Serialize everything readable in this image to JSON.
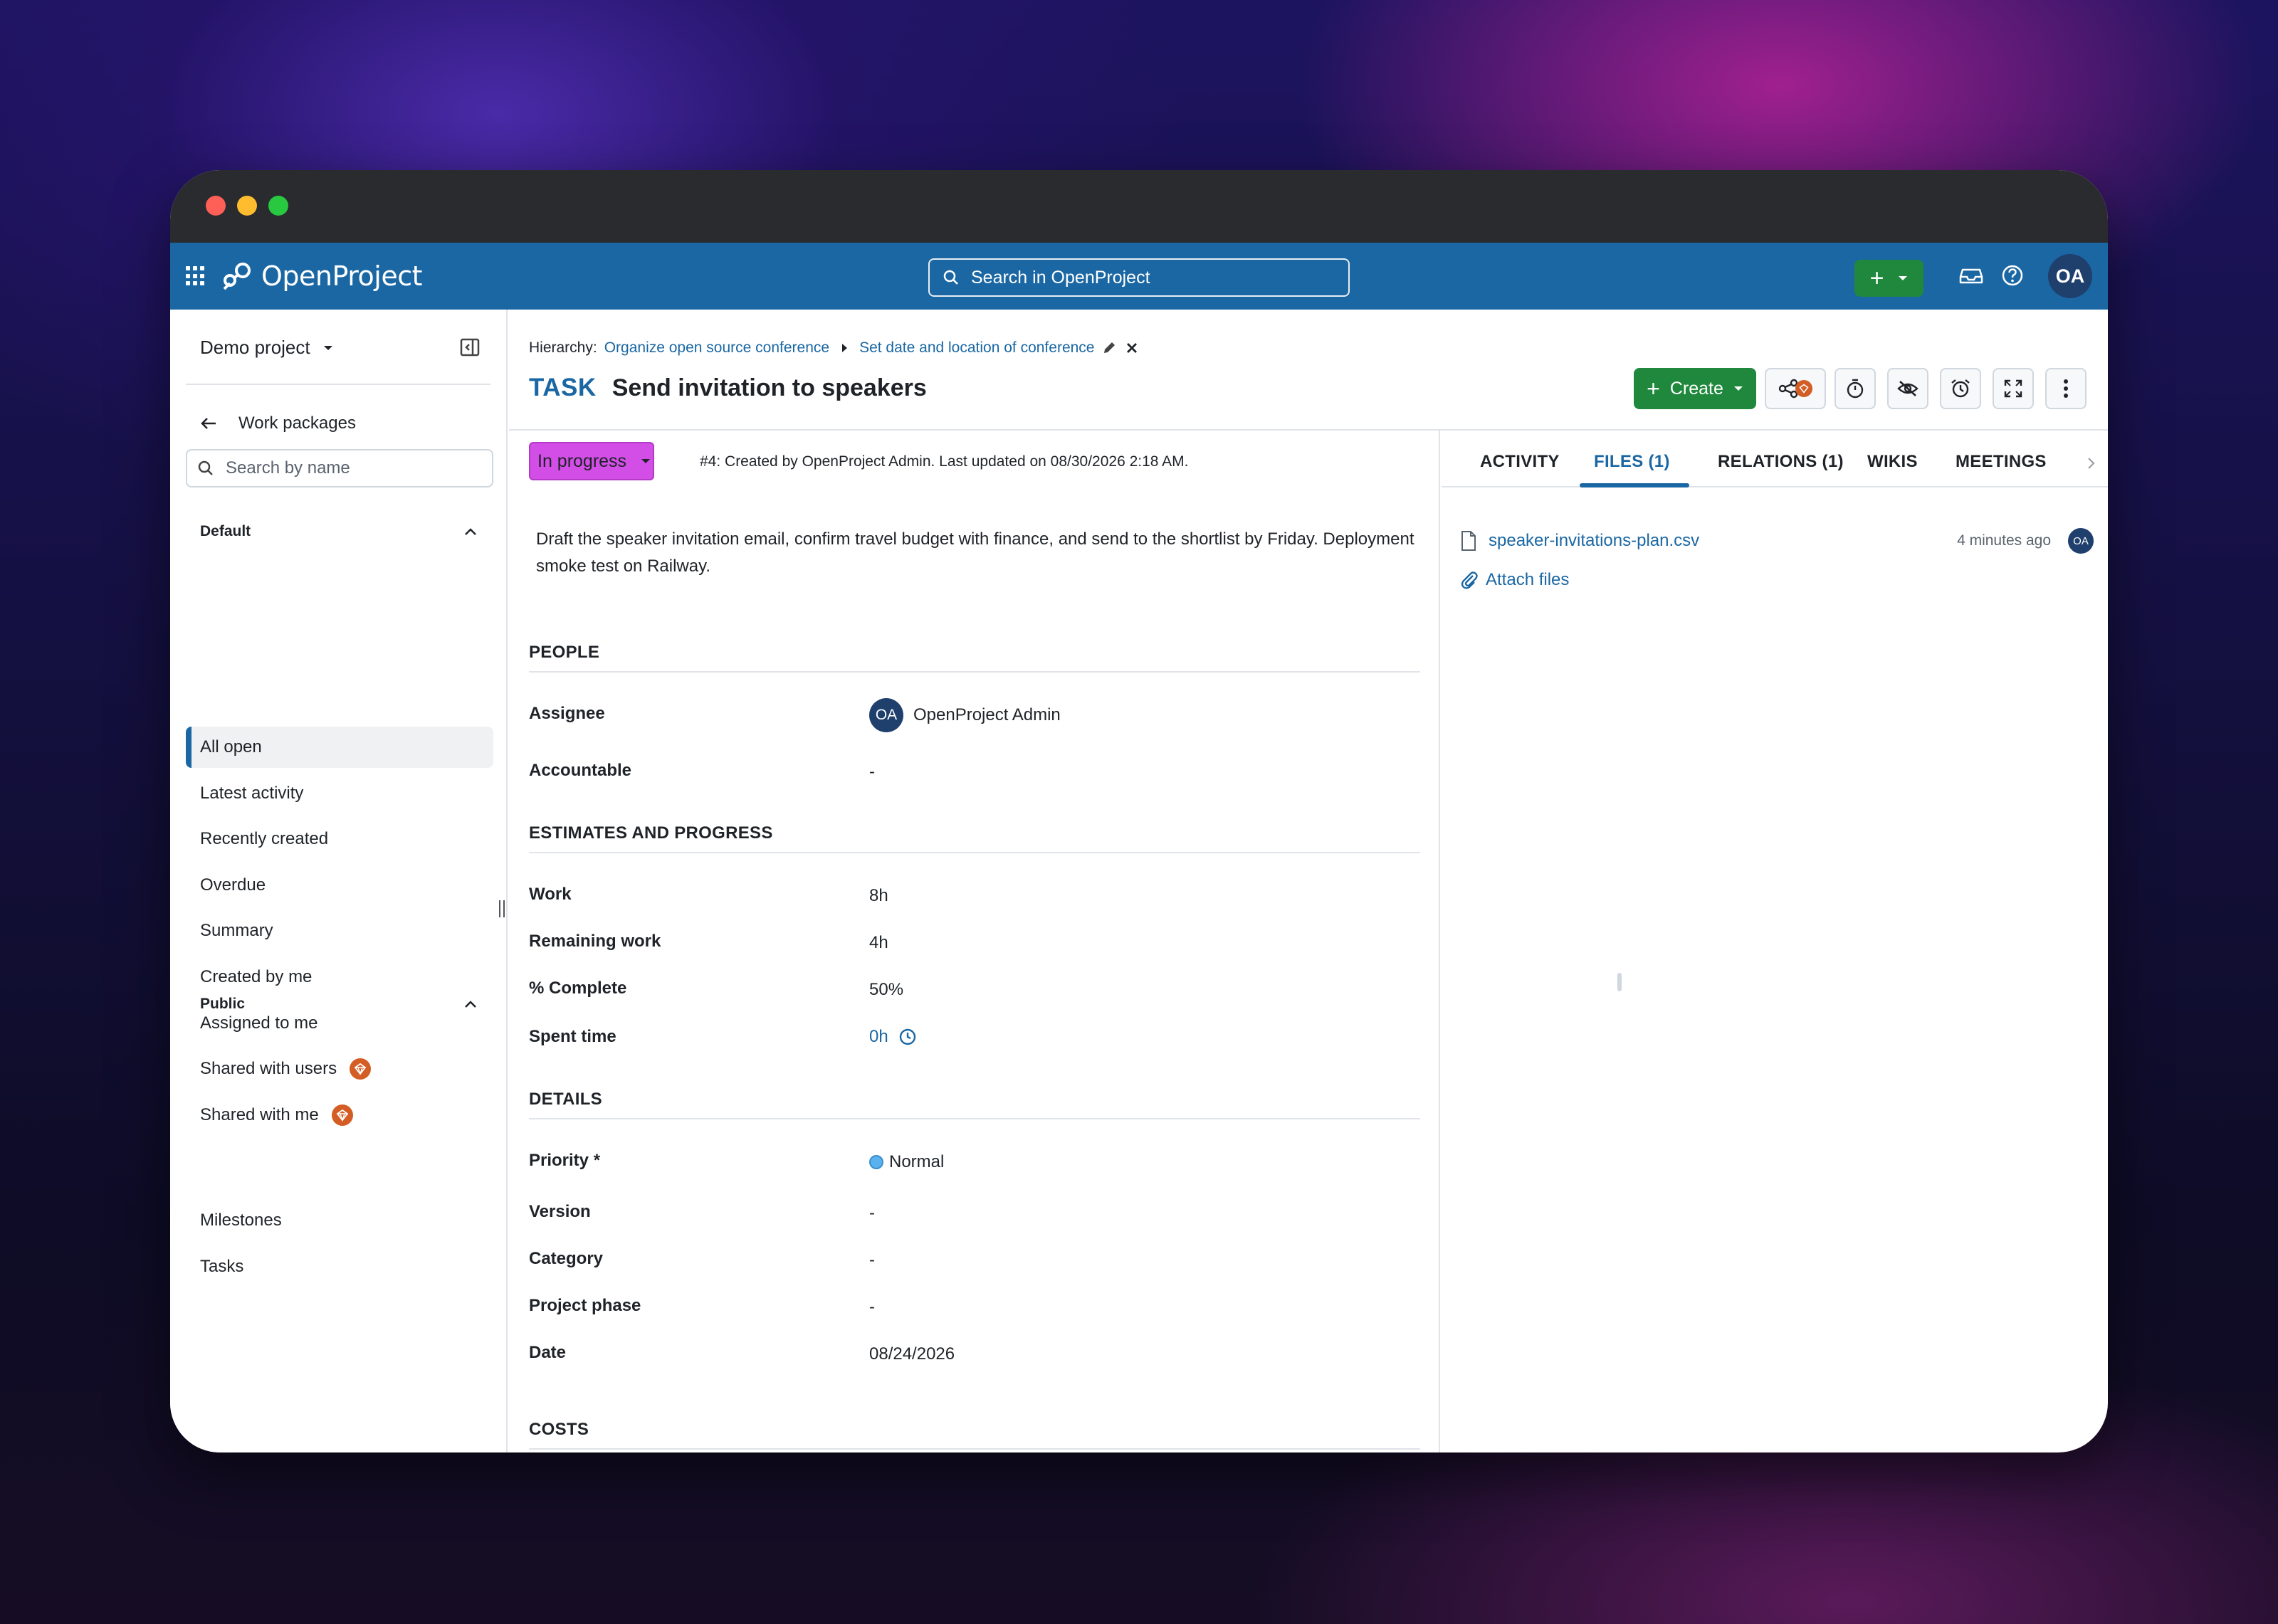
{
  "app": {
    "name": "OpenProject"
  },
  "search": {
    "placeholder": "Search in OpenProject"
  },
  "user": {
    "initials": "OA"
  },
  "sidebar": {
    "project": "Demo project",
    "back_label": "Work packages",
    "search_placeholder": "Search by name",
    "sections": [
      {
        "title": "Default",
        "items": [
          {
            "label": "All open",
            "active": true
          },
          {
            "label": "Latest activity"
          },
          {
            "label": "Recently created"
          },
          {
            "label": "Overdue"
          },
          {
            "label": "Summary"
          },
          {
            "label": "Created by me"
          },
          {
            "label": "Assigned to me"
          },
          {
            "label": "Shared with users",
            "enterprise": true
          },
          {
            "label": "Shared with me",
            "enterprise": true
          }
        ]
      },
      {
        "title": "Public",
        "items": [
          {
            "label": "Milestones"
          },
          {
            "label": "Tasks"
          }
        ]
      }
    ]
  },
  "hierarchy": {
    "label": "Hierarchy:",
    "parent": "Organize open source conference",
    "current": "Set date and location of conference"
  },
  "work_package": {
    "type": "TASK",
    "title": "Send invitation to speakers",
    "status": "In progress",
    "status_color": "#d24ee6",
    "meta": "#4: Created by OpenProject Admin. Last updated on 08/30/2026 2:18 AM.",
    "description": "Draft the speaker invitation email, confirm travel budget with finance, and send to the shortlist by Friday. Deployment smoke test on Railway."
  },
  "toolbar": {
    "create_label": "Create"
  },
  "sections": {
    "people": "PEOPLE",
    "estimates": "ESTIMATES AND PROGRESS",
    "details": "DETAILS",
    "costs": "COSTS"
  },
  "fields": {
    "assignee": {
      "label": "Assignee",
      "value": "OpenProject Admin",
      "initials": "OA"
    },
    "accountable": {
      "label": "Accountable",
      "value": "-"
    },
    "work": {
      "label": "Work",
      "value": "8h"
    },
    "remaining_work": {
      "label": "Remaining work",
      "value": "4h"
    },
    "percent_complete": {
      "label": "% Complete",
      "value": "50%"
    },
    "spent_time": {
      "label": "Spent time",
      "value": "0h"
    },
    "priority": {
      "label": "Priority *",
      "value": "Normal"
    },
    "version": {
      "label": "Version",
      "value": "-"
    },
    "category": {
      "label": "Category",
      "value": "-"
    },
    "project_phase": {
      "label": "Project phase",
      "value": "-"
    },
    "date": {
      "label": "Date",
      "value": "08/24/2026"
    }
  },
  "tabs": [
    {
      "label": "ACTIVITY"
    },
    {
      "label": "FILES (1)",
      "active": true
    },
    {
      "label": "RELATIONS (1)"
    },
    {
      "label": "WIKIS"
    },
    {
      "label": "MEETINGS"
    }
  ],
  "files": [
    {
      "name": "speaker-invitations-plan.csv",
      "time": "4 minutes ago",
      "initials": "OA"
    }
  ],
  "attach_label": "Attach files",
  "colors": {
    "brand": "#1a67a3",
    "create": "#1f883d",
    "enterprise": "#d35d24"
  }
}
